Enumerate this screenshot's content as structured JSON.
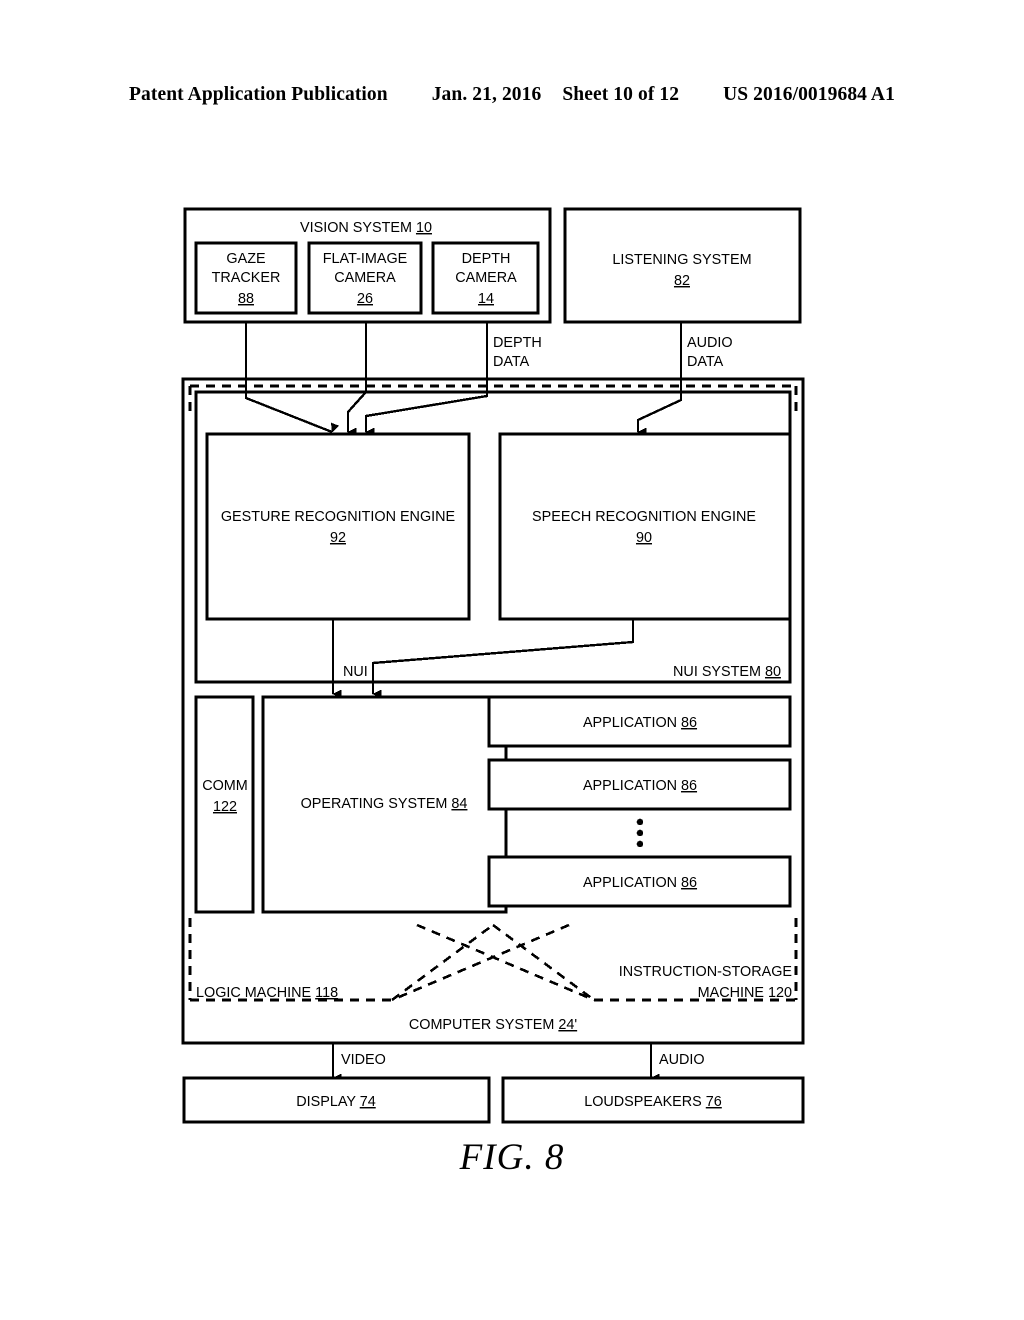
{
  "header": {
    "publication": "Patent Application Publication",
    "date": "Jan. 21, 2016",
    "sheet": "Sheet 10 of 12",
    "patent_number": "US 2016/0019684 A1"
  },
  "figure": {
    "caption": "FIG. 8",
    "vision_system": {
      "title": "VISION SYSTEM",
      "ref": "10",
      "components": [
        {
          "line1": "GAZE",
          "line2": "TRACKER",
          "ref": "88"
        },
        {
          "line1": "FLAT-IMAGE",
          "line2": "CAMERA",
          "ref": "26"
        },
        {
          "line1": "DEPTH",
          "line2": "CAMERA",
          "ref": "14"
        }
      ]
    },
    "listening_system": {
      "title": "LISTENING SYSTEM",
      "ref": "82"
    },
    "signals": {
      "depth_data": {
        "line1": "DEPTH",
        "line2": "DATA"
      },
      "audio_data": {
        "line1": "AUDIO",
        "line2": "DATA"
      },
      "nui": "NUI",
      "video": "VIDEO",
      "audio": "AUDIO"
    },
    "nui_system": {
      "title": "NUI SYSTEM",
      "ref": "80",
      "engines": [
        {
          "title": "GESTURE RECOGNITION ENGINE",
          "ref": "92"
        },
        {
          "title": "SPEECH RECOGNITION ENGINE",
          "ref": "90"
        }
      ]
    },
    "comm": {
      "title": "COMM",
      "ref": "122"
    },
    "operating_system": {
      "title": "OPERATING SYSTEM",
      "ref": "84"
    },
    "applications": [
      {
        "title": "APPLICATION",
        "ref": "86"
      },
      {
        "title": "APPLICATION",
        "ref": "86"
      },
      {
        "title": "APPLICATION",
        "ref": "86"
      }
    ],
    "application_ellipsis": "⋮",
    "logic_machine": {
      "title": "LOGIC MACHINE",
      "ref": "118"
    },
    "instruction_storage_machine": {
      "line1": "INSTRUCTION-STORAGE",
      "line2": "MACHINE 120"
    },
    "computer_system": {
      "title": "COMPUTER SYSTEM",
      "ref": "24'"
    },
    "outputs": [
      {
        "title": "DISPLAY",
        "ref": "74"
      },
      {
        "title": "LOUDSPEAKERS",
        "ref": "76"
      }
    ]
  },
  "colors": {
    "ink": "#000000",
    "paper": "#ffffff"
  }
}
